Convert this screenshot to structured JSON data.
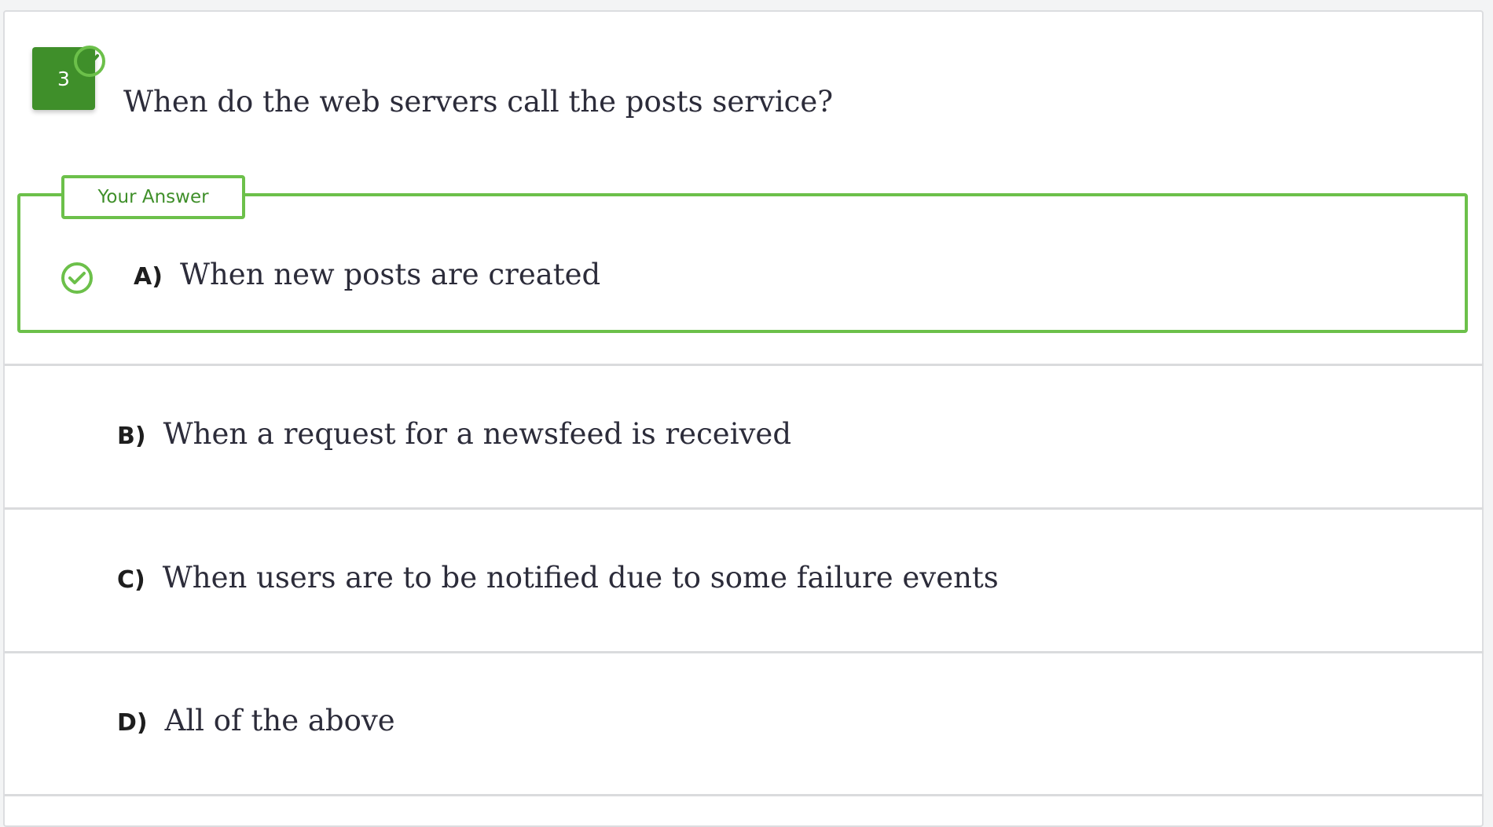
{
  "question": {
    "number": "3",
    "text": "When do the web servers call the posts service?",
    "status": "answered-correct"
  },
  "your_answer_label": "Your Answer",
  "options": [
    {
      "letter": "A)",
      "text": "When new posts are created",
      "selected": true,
      "correct": true
    },
    {
      "letter": "B)",
      "text": "When a request for a newsfeed is received",
      "selected": false
    },
    {
      "letter": "C)",
      "text": "When users are to be notified due to some failure events",
      "selected": false
    },
    {
      "letter": "D)",
      "text": "All of the above",
      "selected": false
    }
  ],
  "colors": {
    "accent_green": "#6cc04a",
    "badge_green": "#3f8f2a",
    "text": "#2c2c3a",
    "divider": "#dadbdd"
  },
  "icons": {
    "badge_check": "check-circle-icon",
    "answer_check": "check-circle-icon"
  }
}
